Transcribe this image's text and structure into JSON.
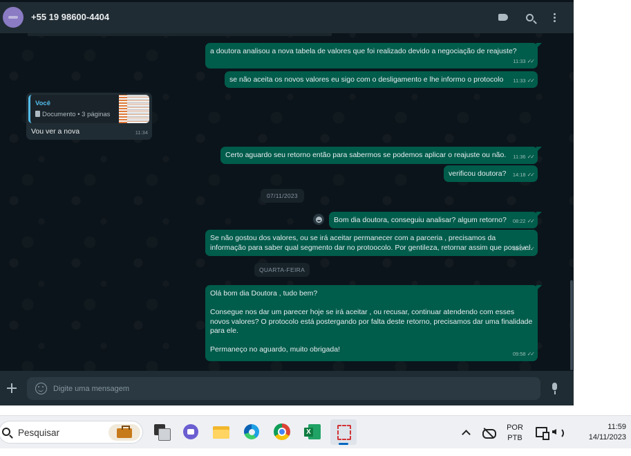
{
  "header": {
    "contact": "+55 19 98600-4404"
  },
  "icons": {
    "tag": "tag-icon",
    "search": "search-icon",
    "menu": "kebab-menu-icon",
    "attach": "plus-icon",
    "emoji": "emoji-icon",
    "mic": "mic-icon"
  },
  "messages": [
    {
      "dir": "out",
      "text": "a doutora analisou a nova tabela de valores que foi realizado devido a negociação de reajuste?",
      "time": "11:33"
    },
    {
      "dir": "out",
      "text": "se não aceita os novos valores eu sigo com o desligamento e lhe informo o protocolo",
      "time": "11:33"
    },
    {
      "dir": "in",
      "quote_author": "Você",
      "quote_doc": "Documento • 3 páginas",
      "text": "Vou ver a nova",
      "time": "11:34"
    },
    {
      "dir": "out",
      "text": "Certo aguardo seu retorno então para sabermos se podemos aplicar o reajuste ou não.",
      "time": "11:36"
    },
    {
      "dir": "out",
      "text": "verificou doutora?",
      "time": "14:18"
    },
    {
      "dir": "out",
      "text": "Bom dia doutora, conseguiu analisar? algum retorno?",
      "time": "08:22"
    },
    {
      "dir": "out",
      "text": "Se não gostou dos valores, ou se irá aceitar permanecer com a parceria , precisamos da informação para saber qual segmento dar no protoocolo. Por gentileza, retornar assim que possível.",
      "time": "08:24"
    },
    {
      "dir": "out",
      "text": "Olá bom dia Doutora , tudo bem?\n\nConsegue nos dar um parecer hoje se irá aceitar , ou recusar, continuar atendendo com esses novos valores? O protocolo está postergando por falta deste retorno, precisamos dar uma finalidade para ele.\n\nPermaneço no aguardo, muito obrigada!",
      "time": "09:58"
    }
  ],
  "dates": [
    "07/11/2023",
    "QUARTA-FEIRA"
  ],
  "composer": {
    "placeholder": "Digite uma mensagem"
  },
  "taskbar": {
    "search_label": "Pesquisar",
    "lang_line1": "POR",
    "lang_line2": "PTB",
    "time": "11:59",
    "date": "14/11/2023"
  },
  "colors": {
    "outgoing_bubble": "#005c4b",
    "incoming_bubble": "#202c33",
    "chat_bg": "#0b141a",
    "header_bg": "#202c33",
    "quote_accent": "#53bdeb"
  }
}
